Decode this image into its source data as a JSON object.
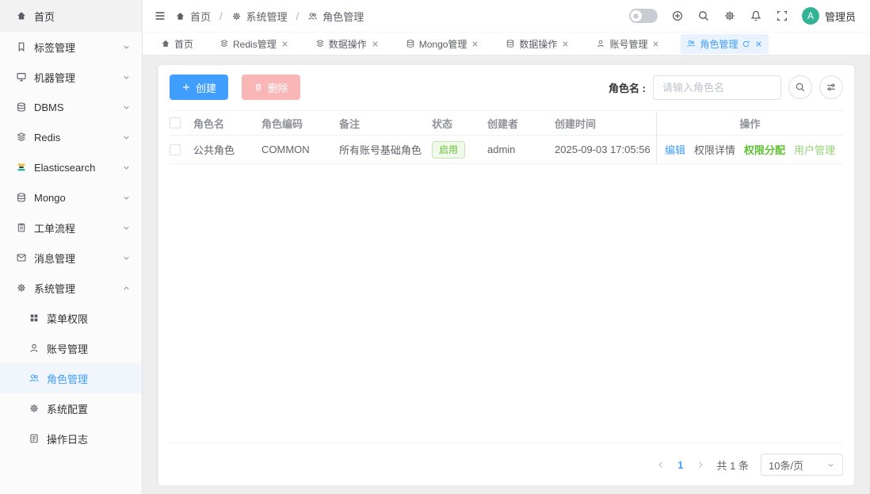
{
  "breadcrumb": {
    "separator": "/",
    "items": [
      {
        "label": "首页"
      },
      {
        "label": "系统管理"
      },
      {
        "label": "角色管理"
      }
    ]
  },
  "header": {
    "user": {
      "initial": "A",
      "name": "管理员"
    }
  },
  "tabs": [
    {
      "label": "首页"
    },
    {
      "label": "Redis管理"
    },
    {
      "label": "数据操作"
    },
    {
      "label": "Mongo管理"
    },
    {
      "label": "数据操作"
    },
    {
      "label": "账号管理"
    },
    {
      "label": "角色管理"
    }
  ],
  "sidebar": {
    "items": [
      {
        "label": "首页"
      },
      {
        "label": "标签管理"
      },
      {
        "label": "机器管理"
      },
      {
        "label": "DBMS"
      },
      {
        "label": "Redis"
      },
      {
        "label": "Elasticsearch"
      },
      {
        "label": "Mongo"
      },
      {
        "label": "工单流程"
      },
      {
        "label": "消息管理"
      },
      {
        "label": "系统管理"
      }
    ],
    "subitems": [
      {
        "label": "菜单权限"
      },
      {
        "label": "账号管理"
      },
      {
        "label": "角色管理"
      },
      {
        "label": "系统配置"
      },
      {
        "label": "操作日志"
      }
    ]
  },
  "toolbar": {
    "create_label": "创建",
    "delete_label": "删除",
    "search_label": "角色名 :",
    "search_placeholder": "请输入角色名"
  },
  "table": {
    "columns": [
      "角色名",
      "角色编码",
      "备注",
      "状态",
      "创建者",
      "创建时间",
      "操作"
    ],
    "rows": [
      {
        "name": "公共角色",
        "code": "COMMON",
        "remark": "所有账号基础角色",
        "status": "启用",
        "creator": "admin",
        "created_at": "2025-09-03 17:05:56",
        "actions": [
          "编辑",
          "权限详情",
          "权限分配",
          "用户管理"
        ]
      }
    ]
  },
  "pagination": {
    "page": "1",
    "total": "共 1 条",
    "page_size": "10条/页"
  },
  "colors": {
    "primary": "#409eff",
    "danger_disabled": "#fab6b6",
    "success": "#67c23a",
    "success_light": "#95d475",
    "avatar": "#34b394",
    "active_tab_bg": "#e8f3ff",
    "status_tag_bg": "#f0f9eb"
  }
}
